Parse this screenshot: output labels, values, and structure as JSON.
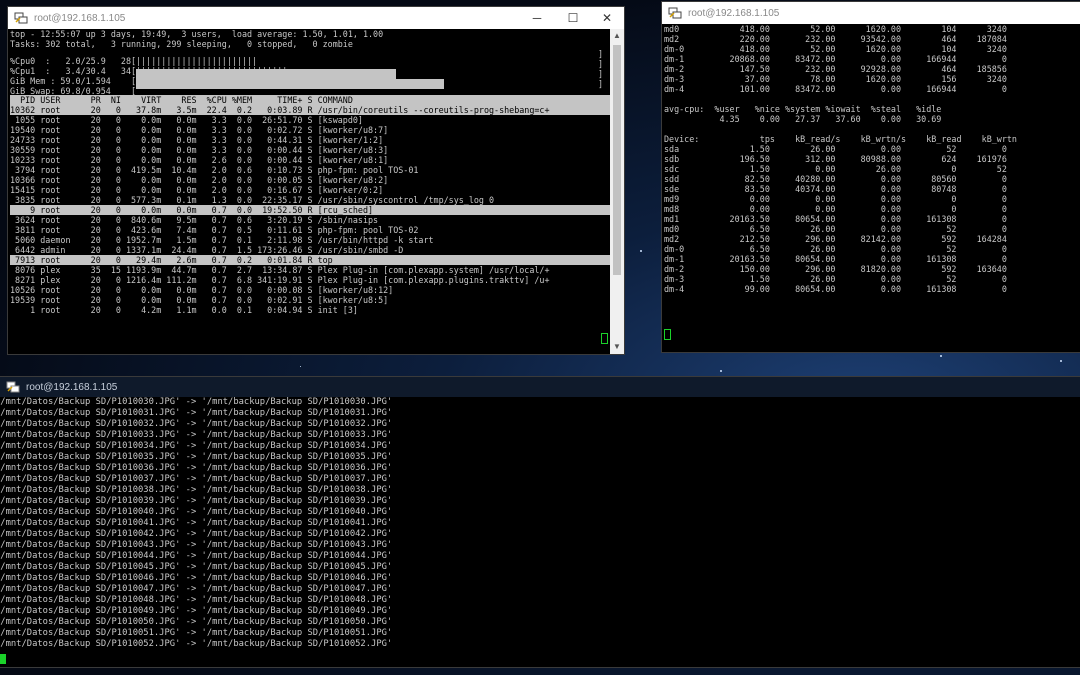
{
  "windows": {
    "top": {
      "title": "root@192.168.1.105",
      "header": [
        "top - 12:55:07 up 3 days, 19:49,  3 users,  load average: 1.50, 1.01, 1.00",
        "Tasks: 302 total,   3 running, 299 sleeping,   0 stopped,   0 zombie"
      ],
      "cpu0_label": "%Cpu0  :   2.0/25.9   28[",
      "cpu0_bar": "||||||||||||||||||||||||",
      "cpu1_label": "%Cpu1  :   3.4/30.4   34[",
      "cpu1_bar": "||||||||||||||||||||||||||||||",
      "cpu0_pct": 28,
      "cpu1_pct": 34,
      "mem_label": "GiB Mem : 59.0/1.594    [",
      "swap_label": "GiB Swap: 69.8/0.954    [",
      "mem_pct": 59,
      "swap_pct": 70,
      "bracket_close": "]",
      "column_header": "  PID USER      PR  NI    VIRT    RES  %CPU %MEM     TIME+ S COMMAND",
      "processes": [
        {
          "text": "10362 root      20   0   37.8m   3.5m  22.4  0.2   0:03.89 R /usr/bin/coreutils --coreutils-prog-shebang=c+",
          "hl": true
        },
        {
          "text": " 1055 root      20   0    0.0m   0.0m   3.3  0.0  26:51.70 S [kswapd0]",
          "hl": false
        },
        {
          "text": "19540 root      20   0    0.0m   0.0m   3.3  0.0   0:02.72 S [kworker/u8:7]",
          "hl": false
        },
        {
          "text": "24733 root      20   0    0.0m   0.0m   3.3  0.0   0:44.31 S [kworker/1:2]",
          "hl": false
        },
        {
          "text": "30559 root      20   0    0.0m   0.0m   3.3  0.0   0:00.44 S [kworker/u8:3]",
          "hl": false
        },
        {
          "text": "10233 root      20   0    0.0m   0.0m   2.6  0.0   0:00.44 S [kworker/u8:1]",
          "hl": false
        },
        {
          "text": " 3794 root      20   0  419.5m  10.4m   2.0  0.6   0:10.73 S php-fpm: pool TOS-01",
          "hl": false
        },
        {
          "text": "10366 root      20   0    0.0m   0.0m   2.0  0.0   0:00.05 S [kworker/u8:2]",
          "hl": false
        },
        {
          "text": "15415 root      20   0    0.0m   0.0m   2.0  0.0   0:16.67 S [kworker/0:2]",
          "hl": false
        },
        {
          "text": " 3835 root      20   0  577.3m   0.1m   1.3  0.0  22:35.17 S /usr/sbin/syscontrol /tmp/sys_log 0",
          "hl": false
        },
        {
          "text": "    9 root      20   0    0.0m   0.0m   0.7  0.0  19:52.50 R [rcu_sched]",
          "hl": true
        },
        {
          "text": " 3624 root      20   0  840.6m   9.5m   0.7  0.6   3:20.19 S /sbin/nasips",
          "hl": false
        },
        {
          "text": " 3811 root      20   0  423.6m   7.4m   0.7  0.5   0:11.61 S php-fpm: pool TOS-02",
          "hl": false
        },
        {
          "text": " 5060 daemon    20   0 1952.7m   1.5m   0.7  0.1   2:11.98 S /usr/bin/httpd -k start",
          "hl": false
        },
        {
          "text": " 6442 admin     20   0 1337.1m  24.4m   0.7  1.5 173:26.46 S /usr/sbin/smbd -D",
          "hl": false
        },
        {
          "text": " 7913 root      20   0   29.4m   2.6m   0.7  0.2   0:01.84 R top",
          "hl": true
        },
        {
          "text": " 8076 plex      35  15 1193.9m  44.7m   0.7  2.7  13:34.87 S Plex Plug-in [com.plexapp.system] /usr/local/+",
          "hl": false
        },
        {
          "text": " 8271 plex      20   0 1216.4m 111.2m   0.7  6.8 341:19.91 S Plex Plug-in [com.plexapp.plugins.trakttv] /u+",
          "hl": false
        },
        {
          "text": "10526 root      20   0    0.0m   0.0m   0.7  0.0   0:00.08 S [kworker/u8:12]",
          "hl": false
        },
        {
          "text": "19539 root      20   0    0.0m   0.0m   0.7  0.0   0:02.91 S [kworker/u8:5]",
          "hl": false
        },
        {
          "text": "    1 root      20   0    4.2m   1.1m   0.0  0.1   0:04.94 S init [3]",
          "hl": false
        }
      ],
      "controls": {
        "minimize": "─",
        "maximize": "☐",
        "close": "✕"
      }
    },
    "iostat": {
      "title": "root@192.168.1.105",
      "lines": [
        "md0            418.00        52.00      1620.00        104      3240",
        "md2            220.00       232.00     93542.00        464    187084",
        "dm-0           418.00        52.00      1620.00        104      3240",
        "dm-1         20868.00     83472.00         0.00     166944         0",
        "dm-2           147.50       232.00     92928.00        464    185856",
        "dm-3            37.00        78.00      1620.00        156      3240",
        "dm-4           101.00     83472.00         0.00     166944         0",
        "",
        "avg-cpu:  %user   %nice %system %iowait  %steal   %idle",
        "           4.35    0.00   27.37   37.60    0.00   30.69",
        "",
        "Device:            tps    kB_read/s    kB_wrtn/s    kB_read    kB_wrtn",
        "sda              1.50        26.00         0.00         52         0",
        "sdb            196.50       312.00     80988.00        624    161976",
        "sdc              1.50         0.00        26.00          0        52",
        "sdd             82.50     40280.00         0.00      80560         0",
        "sde             83.50     40374.00         0.00      80748         0",
        "md9              0.00         0.00         0.00          0         0",
        "md8              0.00         0.00         0.00          0         0",
        "md1          20163.50     80654.00         0.00     161308         0",
        "md0              6.50        26.00         0.00         52         0",
        "md2            212.50       296.00     82142.00        592    164284",
        "dm-0             6.50        26.00         0.00         52         0",
        "dm-1         20163.50     80654.00         0.00     161308         0",
        "dm-2           150.00       296.00     81820.00        592    163640",
        "dm-3             1.50        26.00         0.00         52         0",
        "dm-4            99.00     80654.00         0.00     161308         0"
      ]
    },
    "copy": {
      "title": "root@192.168.1.105",
      "lines": [
        "'/mnt/Datos/Backup SD/P1010030.JPG' -> '/mnt/backup/Backup SD/P1010030.JPG'",
        "'/mnt/Datos/Backup SD/P1010031.JPG' -> '/mnt/backup/Backup SD/P1010031.JPG'",
        "'/mnt/Datos/Backup SD/P1010032.JPG' -> '/mnt/backup/Backup SD/P1010032.JPG'",
        "'/mnt/Datos/Backup SD/P1010033.JPG' -> '/mnt/backup/Backup SD/P1010033.JPG'",
        "'/mnt/Datos/Backup SD/P1010034.JPG' -> '/mnt/backup/Backup SD/P1010034.JPG'",
        "'/mnt/Datos/Backup SD/P1010035.JPG' -> '/mnt/backup/Backup SD/P1010035.JPG'",
        "'/mnt/Datos/Backup SD/P1010036.JPG' -> '/mnt/backup/Backup SD/P1010036.JPG'",
        "'/mnt/Datos/Backup SD/P1010037.JPG' -> '/mnt/backup/Backup SD/P1010037.JPG'",
        "'/mnt/Datos/Backup SD/P1010038.JPG' -> '/mnt/backup/Backup SD/P1010038.JPG'",
        "'/mnt/Datos/Backup SD/P1010039.JPG' -> '/mnt/backup/Backup SD/P1010039.JPG'",
        "'/mnt/Datos/Backup SD/P1010040.JPG' -> '/mnt/backup/Backup SD/P1010040.JPG'",
        "'/mnt/Datos/Backup SD/P1010041.JPG' -> '/mnt/backup/Backup SD/P1010041.JPG'",
        "'/mnt/Datos/Backup SD/P1010042.JPG' -> '/mnt/backup/Backup SD/P1010042.JPG'",
        "'/mnt/Datos/Backup SD/P1010043.JPG' -> '/mnt/backup/Backup SD/P1010043.JPG'",
        "'/mnt/Datos/Backup SD/P1010044.JPG' -> '/mnt/backup/Backup SD/P1010044.JPG'",
        "'/mnt/Datos/Backup SD/P1010045.JPG' -> '/mnt/backup/Backup SD/P1010045.JPG'",
        "'/mnt/Datos/Backup SD/P1010046.JPG' -> '/mnt/backup/Backup SD/P1010046.JPG'",
        "'/mnt/Datos/Backup SD/P1010047.JPG' -> '/mnt/backup/Backup SD/P1010047.JPG'",
        "'/mnt/Datos/Backup SD/P1010048.JPG' -> '/mnt/backup/Backup SD/P1010048.JPG'",
        "'/mnt/Datos/Backup SD/P1010049.JPG' -> '/mnt/backup/Backup SD/P1010049.JPG'",
        "'/mnt/Datos/Backup SD/P1010050.JPG' -> '/mnt/backup/Backup SD/P1010050.JPG'",
        "'/mnt/Datos/Backup SD/P1010051.JPG' -> '/mnt/backup/Backup SD/P1010051.JPG'",
        "'/mnt/Datos/Backup SD/P1010052.JPG' -> '/mnt/backup/Backup SD/P1010052.JPG'"
      ]
    }
  },
  "colors": {
    "terminal_bg": "#000000",
    "terminal_fg": "#c8c8c8",
    "highlight_bg": "#c4c4c4",
    "cursor": "#1bd22a"
  }
}
